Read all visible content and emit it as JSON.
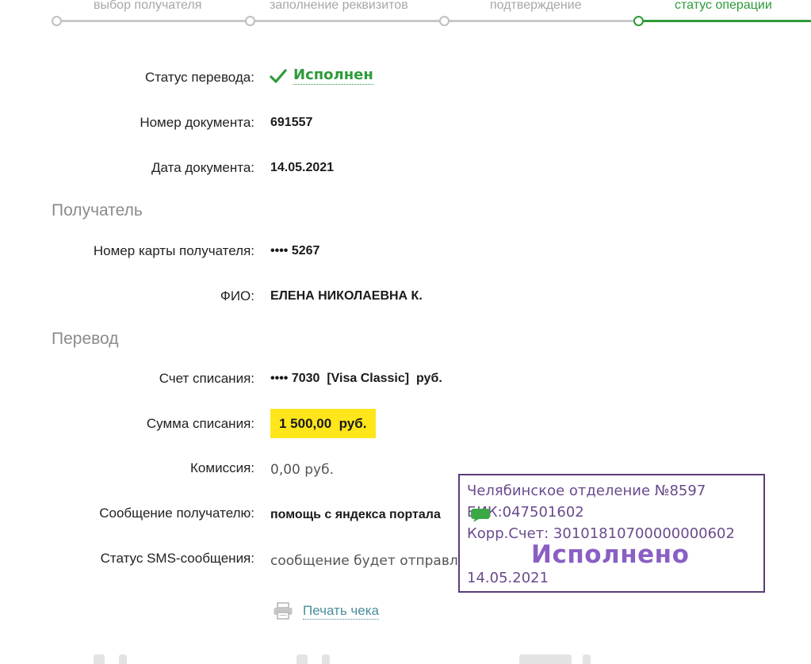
{
  "stepper": {
    "steps": [
      {
        "label": "выбор получателя"
      },
      {
        "label": "заполнение реквизитов"
      },
      {
        "label": "подтверждение"
      },
      {
        "label": "статус операции"
      }
    ]
  },
  "details": {
    "status_label": "Статус перевода:",
    "status_value": "Исполнен",
    "doc_number_label": "Номер документа:",
    "doc_number_value": "691557",
    "doc_date_label": "Дата документа:",
    "doc_date_value": "14.05.2021"
  },
  "recipient": {
    "section_title": "Получатель",
    "card_label": "Номер карты получателя:",
    "card_value": "•••• 5267",
    "name_label": "ФИО:",
    "name_value": "ЕЛЕНА НИКОЛАЕВНА К."
  },
  "transfer": {
    "section_title": "Перевод",
    "account_label": "Счет списания:",
    "account_value": "•••• 7030  [Visa Classic]  руб.",
    "amount_label": "Сумма списания:",
    "amount_value": "1 500,00  руб.",
    "fee_label": "Комиссия:",
    "fee_value": "0,00 руб.",
    "message_label": "Сообщение получателю:",
    "message_value": "помощь с яндекса портала",
    "sms_label": "Статус SMS-сообщения:",
    "sms_value": "сообщение будет отправлено"
  },
  "stamp": {
    "branch": "Челябинское отделение №8597",
    "bik": "БИК:047501602",
    "corr": "Корр.Счет: 30101810700000000602",
    "status": "Исполнено",
    "date": "14.05.2021"
  },
  "actions": {
    "print_label": "Печать чека"
  },
  "colors": {
    "accent_green": "#2d9b3a",
    "highlight_yellow": "#ffe61b",
    "stamp_purple": "#6a4b8d"
  }
}
